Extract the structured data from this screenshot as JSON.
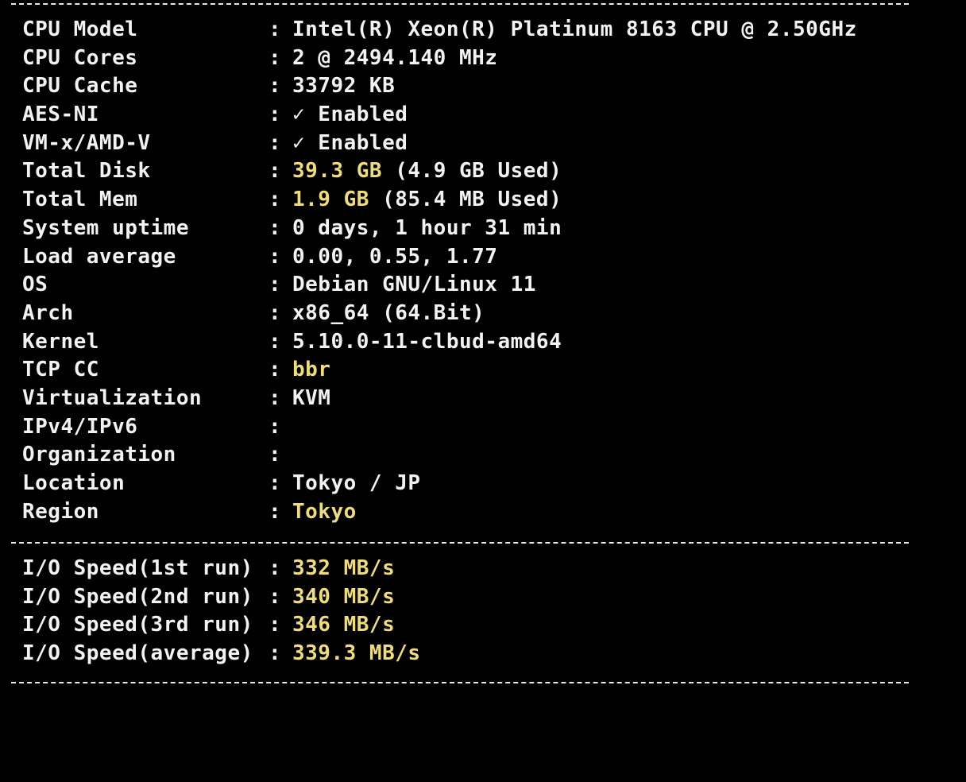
{
  "colors": {
    "background": "#000000",
    "text": "#f2f2f2",
    "highlight": "#eedc7d"
  },
  "separators": {
    "top": "-----------------------------------------------------------------------",
    "middle": "-----------------------------------------------------------------------",
    "bottom": "-----------------------------------------------------------------------"
  },
  "colon": ":",
  "system_info": [
    {
      "label": "CPU Model",
      "value": "Intel(R) Xeon(R) Platinum 8163 CPU @ 2.50GHz",
      "extra": ""
    },
    {
      "label": "CPU Cores",
      "value": "2 @ 2494.140 MHz",
      "extra": ""
    },
    {
      "label": "CPU Cache",
      "value": "33792 KB",
      "extra": ""
    },
    {
      "label": "AES-NI",
      "value": "✓ Enabled",
      "extra": ""
    },
    {
      "label": "VM-x/AMD-V",
      "value": "✓ Enabled",
      "extra": ""
    },
    {
      "label": "Total Disk",
      "value": "39.3 GB",
      "extra": " (4.9 GB Used)"
    },
    {
      "label": "Total Mem",
      "value": "1.9 GB",
      "extra": " (85.4 MB Used)"
    },
    {
      "label": "System uptime",
      "value": "0 days, 1 hour 31 min",
      "extra": ""
    },
    {
      "label": "Load average",
      "value": "0.00, 0.55, 1.77",
      "extra": ""
    },
    {
      "label": "OS",
      "value": "Debian GNU/Linux 11",
      "extra": ""
    },
    {
      "label": "Arch",
      "value": "x86_64 (64.Bit)",
      "extra": ""
    },
    {
      "label": "Kernel",
      "value": "5.10.0-11-clbud-amd64",
      "extra": ""
    },
    {
      "label": "TCP CC",
      "value": "bbr",
      "extra": ""
    },
    {
      "label": "Virtualization",
      "value": "KVM",
      "extra": ""
    },
    {
      "label": "IPv4/IPv6",
      "value": "",
      "extra": ""
    },
    {
      "label": "Organization",
      "value": "",
      "extra": ""
    },
    {
      "label": "Location",
      "value": "Tokyo / JP",
      "extra": ""
    },
    {
      "label": "Region",
      "value": "Tokyo",
      "extra": ""
    }
  ],
  "io_speed": [
    {
      "label": "I/O Speed(1st run)",
      "value": "332 MB/s"
    },
    {
      "label": "I/O Speed(2nd run)",
      "value": "340 MB/s"
    },
    {
      "label": "I/O Speed(3rd run)",
      "value": "346 MB/s"
    },
    {
      "label": "I/O Speed(average)",
      "value": "339.3 MB/s"
    }
  ]
}
